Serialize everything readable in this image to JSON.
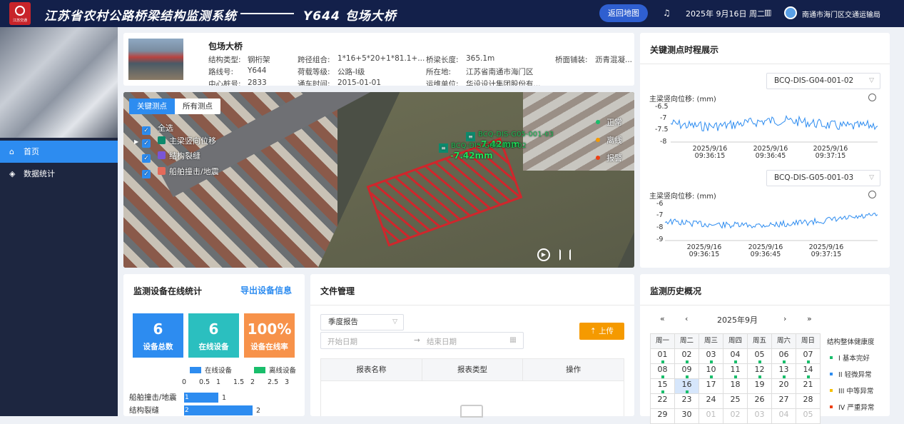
{
  "header": {
    "app_title": "江苏省农村公路桥梁结构监测系统",
    "bridge_title": "Y644 包场大桥",
    "back_button": "返回地图",
    "date": "2025年 9月16日 周二",
    "org": "南通市海门区交通运输局",
    "logo_text": "江苏交通"
  },
  "sidebar": {
    "items": [
      {
        "label": "首页",
        "icon": "home-icon",
        "active": true
      },
      {
        "label": "数据统计",
        "icon": "layers-icon",
        "active": false
      }
    ]
  },
  "bridge_info": {
    "name": "包场大桥",
    "rows": [
      [
        "结构类型:",
        "钢桁架",
        "跨径组合:",
        "1*16+5*20+1*81.1+...",
        "桥梁长度:",
        "365.1m",
        "桥面铺装:",
        "沥青混凝..."
      ],
      [
        "路线号:",
        "Y644",
        "荷载等级:",
        "公路-I级",
        "所在地:",
        "江苏省南通市海门区"
      ],
      [
        "中心桩号:",
        "2833",
        "通车时间:",
        "2015-01-01",
        "运维单位:",
        "华设设计集团股份有..."
      ]
    ]
  },
  "map": {
    "tabs": [
      "关键测点",
      "所有测点"
    ],
    "filters": [
      "全选",
      "主梁竖向位移",
      "结构裂缝",
      "船舶撞击/地震"
    ],
    "legend": [
      {
        "label": "正常",
        "color": "#19be6b"
      },
      {
        "label": "离线",
        "color": "#f59a00"
      },
      {
        "label": "报警",
        "color": "#ed4014"
      }
    ],
    "sensors": [
      {
        "id": "BCQ-DIS-G05-001-03",
        "value": "-7.42mm"
      },
      {
        "id": "BCQ-DIS-G04-001-02",
        "value": "-7.42mm"
      }
    ]
  },
  "timeline": {
    "title": "关键测点时程展示",
    "charts": [
      {
        "selected": "BCQ-DIS-G04-001-02",
        "ylabel": "主梁竖向位移: (mm)",
        "yticks": [
          "-6.5",
          "-7",
          "-7.5",
          "-8"
        ],
        "xticks": [
          [
            "2025/9/16",
            "09:36:15"
          ],
          [
            "2025/9/16",
            "09:36:45"
          ],
          [
            "2025/9/16",
            "09:37:15"
          ]
        ]
      },
      {
        "selected": "BCQ-DIS-G05-001-03",
        "ylabel": "主梁竖向位移: (mm)",
        "yticks": [
          "-6",
          "-7",
          "-8",
          "-9"
        ],
        "xticks": [
          [
            "2025/9/16",
            "09:36:15"
          ],
          [
            "2025/9/16",
            "09:36:45"
          ],
          [
            "2025/9/16",
            "09:37:15"
          ]
        ]
      }
    ]
  },
  "devices": {
    "title": "监测设备在线统计",
    "export": "导出设备信息",
    "stats": [
      {
        "value": "6",
        "label": "设备总数",
        "color": "#2d8cf0"
      },
      {
        "value": "6",
        "label": "在线设备",
        "color": "#2bbfbf"
      },
      {
        "value": "100%",
        "label": "设备在线率",
        "color": "#f7924a"
      }
    ],
    "legend": [
      {
        "label": "在线设备",
        "color": "#2d8cf0"
      },
      {
        "label": "离线设备",
        "color": "#19be6b"
      }
    ],
    "axis": [
      "0",
      "0.5",
      "1",
      "1.5",
      "2",
      "2.5",
      "3"
    ]
  },
  "chart_data": {
    "type": "bar",
    "categories": [
      "船舶撞击/地震",
      "结构裂缝"
    ],
    "series": [
      {
        "name": "在线设备",
        "values": [
          1,
          2
        ]
      }
    ],
    "xlim": [
      0,
      3
    ],
    "orientation": "horizontal"
  },
  "files": {
    "title": "文件管理",
    "report_type": "季度报告",
    "start_placeholder": "开始日期",
    "arrow": "→",
    "end_placeholder": "结束日期",
    "upload": "上传",
    "columns": [
      "报表名称",
      "报表类型",
      "操作"
    ]
  },
  "history": {
    "title": "监测历史概况",
    "nav": [
      "«",
      "‹",
      "2025年9月",
      "›",
      "»"
    ],
    "weekdays": [
      "周一",
      "周二",
      "周三",
      "周四",
      "周五",
      "周六",
      "周日"
    ],
    "weeks": [
      [
        "01",
        "02",
        "03",
        "04",
        "05",
        "06",
        "07"
      ],
      [
        "08",
        "09",
        "10",
        "11",
        "12",
        "13",
        "14"
      ],
      [
        "15",
        "16",
        "17",
        "18",
        "19",
        "20",
        "21"
      ],
      [
        "22",
        "23",
        "24",
        "25",
        "26",
        "27",
        "28"
      ],
      [
        "29",
        "30",
        "01",
        "02",
        "03",
        "04",
        "05"
      ]
    ],
    "health_title": "结构整体健康度",
    "health": [
      {
        "label": "I 基本完好",
        "color": "#19be6b"
      },
      {
        "label": "II 轻微异常",
        "color": "#2d8cf0"
      },
      {
        "label": "III 中等异常",
        "color": "#f5c000"
      },
      {
        "label": "IV 严重异常",
        "color": "#ed4014"
      }
    ]
  }
}
